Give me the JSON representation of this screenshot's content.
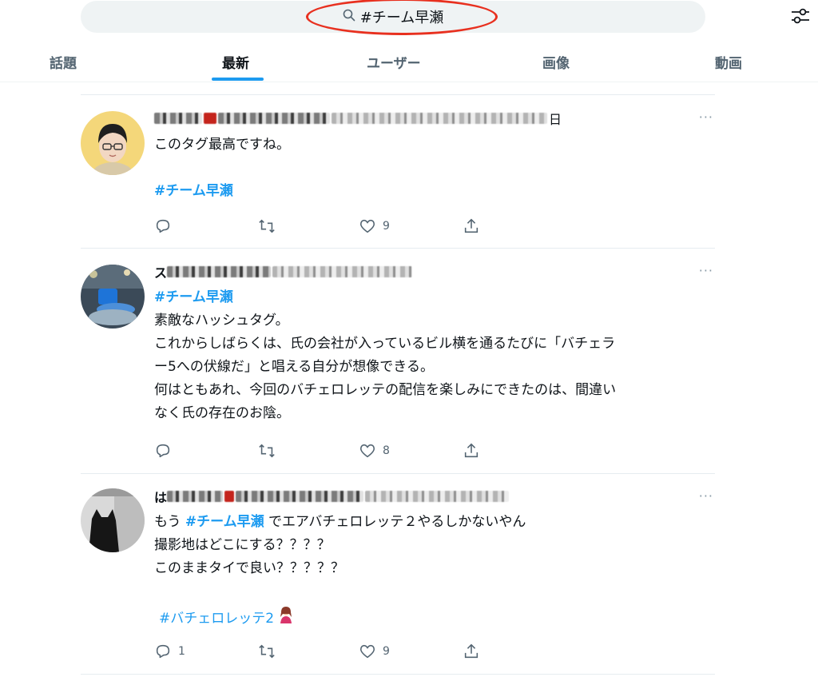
{
  "search": {
    "query": "#チーム早瀬"
  },
  "tabs": [
    {
      "label": "話題"
    },
    {
      "label": "最新"
    },
    {
      "label": "ユーザー"
    },
    {
      "label": "画像"
    },
    {
      "label": "動画"
    }
  ],
  "tweets": [
    {
      "name_suffix": "日",
      "lines": [
        "このタグ最高ですね。"
      ],
      "hashtag": "#チーム早瀬",
      "likes": "9",
      "replies": ""
    },
    {
      "name_prefix": "ス",
      "hashtag": "#チーム早瀬",
      "lines": [
        "素敵なハッシュタグ。",
        "これからしばらくは、氏の会社が入っているビル横を通るたびに「バチェラ",
        "ー5への伏線だ」と唱える自分が想像できる。",
        "何はともあれ、今回のバチェロレッテの配信を楽しみにできたのは、間違い",
        "なく氏の存在のお陰。"
      ],
      "likes": "8",
      "replies": ""
    },
    {
      "name_prefix": "は",
      "line1_before": "もう ",
      "line1_hashtag": "#チーム早瀬",
      "line1_after": " でエアバチェロレッテ２やるしかないやん",
      "lines": [
        "撮影地はどこにする？？？？",
        "このままタイで良い？？？？？"
      ],
      "hashtag2": "#バチェロレッテ2",
      "likes": "9",
      "replies": "1"
    }
  ],
  "more_glyph": "···",
  "colors": {
    "accent": "#1d9bf0",
    "highlight": "#e8301f"
  }
}
